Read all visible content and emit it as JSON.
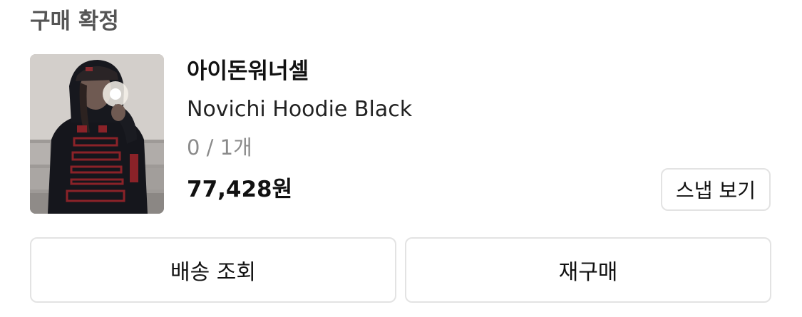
{
  "order": {
    "status": "구매 확정"
  },
  "product": {
    "brand": "아이돈워너셀",
    "name": "Novichi Hoodie Black",
    "quantity": "0 / 1개",
    "price": "77,428원",
    "image_icon": "product-photo"
  },
  "actions": {
    "snap_label": "스냅 보기",
    "track_label": "배송 조회",
    "rebuy_label": "재구매"
  }
}
